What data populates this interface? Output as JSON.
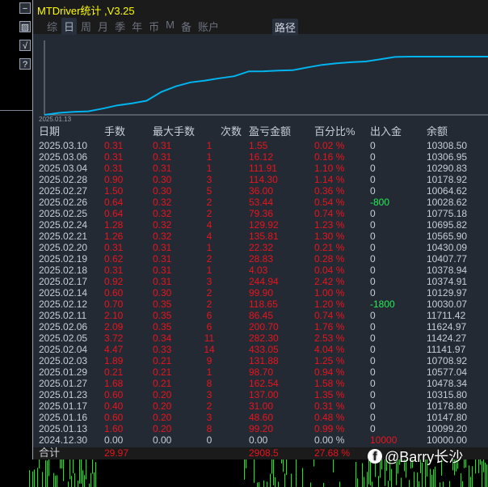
{
  "sidebar": {
    "buttons": [
      {
        "icon": "minus-icon",
        "glyph": "−"
      },
      {
        "icon": "image-icon",
        "glyph": "▨"
      },
      {
        "icon": "check-icon",
        "glyph": "√"
      },
      {
        "icon": "help-icon",
        "glyph": "?"
      }
    ]
  },
  "title": "MTDriver统计 ,V3.25",
  "tabs": [
    {
      "label": "综",
      "active": false
    },
    {
      "label": "日",
      "active": true
    },
    {
      "label": "周",
      "active": false
    },
    {
      "label": "月",
      "active": false
    },
    {
      "label": "季",
      "active": false
    },
    {
      "label": "年",
      "active": false
    },
    {
      "label": "币",
      "active": false
    },
    {
      "label": "M",
      "active": false
    },
    {
      "label": "备",
      "active": false
    },
    {
      "label": "账户",
      "active": false
    }
  ],
  "route_label": "路径",
  "chart": {
    "start_date": "2025.01.13",
    "line_color": "#00b4f0"
  },
  "table": {
    "headers": [
      "日期",
      "手数",
      "最大手数",
      "次数",
      "盈亏金额",
      "百分比%",
      "出入金",
      "余额"
    ],
    "rows": [
      [
        "2025.03.10",
        "0.31",
        "0.31",
        "1",
        "1.55",
        "0.02 %",
        "0",
        "10308.50"
      ],
      [
        "2025.03.06",
        "0.31",
        "0.31",
        "1",
        "16.12",
        "0.16 %",
        "0",
        "10306.95"
      ],
      [
        "2025.03.04",
        "0.31",
        "0.31",
        "1",
        "111.91",
        "1.10 %",
        "0",
        "10290.83"
      ],
      [
        "2025.02.28",
        "0.90",
        "0.30",
        "3",
        "114.30",
        "1.14 %",
        "0",
        "10178.92"
      ],
      [
        "2025.02.27",
        "1.50",
        "0.30",
        "5",
        "36.00",
        "0.36 %",
        "0",
        "10064.62"
      ],
      [
        "2025.02.26",
        "0.64",
        "0.32",
        "2",
        "53.44",
        "0.54 %",
        "-800",
        "10028.62"
      ],
      [
        "2025.02.25",
        "0.64",
        "0.32",
        "2",
        "79.36",
        "0.74 %",
        "0",
        "10775.18"
      ],
      [
        "2025.02.24",
        "1.28",
        "0.32",
        "4",
        "129.92",
        "1.23 %",
        "0",
        "10695.82"
      ],
      [
        "2025.02.21",
        "1.26",
        "0.32",
        "4",
        "135.81",
        "1.30 %",
        "0",
        "10565.90"
      ],
      [
        "2025.02.20",
        "0.31",
        "0.31",
        "1",
        "22.32",
        "0.21 %",
        "0",
        "10430.09"
      ],
      [
        "2025.02.19",
        "0.62",
        "0.31",
        "2",
        "28.83",
        "0.28 %",
        "0",
        "10407.77"
      ],
      [
        "2025.02.18",
        "0.31",
        "0.31",
        "1",
        "4.03",
        "0.04 %",
        "0",
        "10378.94"
      ],
      [
        "2025.02.17",
        "0.92",
        "0.31",
        "3",
        "244.94",
        "2.42 %",
        "0",
        "10374.91"
      ],
      [
        "2025.02.14",
        "0.60",
        "0.30",
        "2",
        "99.90",
        "1.00 %",
        "0",
        "10129.97"
      ],
      [
        "2025.02.12",
        "0.70",
        "0.35",
        "2",
        "118.65",
        "1.20 %",
        "-1800",
        "10030.07"
      ],
      [
        "2025.02.11",
        "2.10",
        "0.35",
        "6",
        "86.45",
        "0.74 %",
        "0",
        "11711.42"
      ],
      [
        "2025.02.06",
        "2.09",
        "0.35",
        "6",
        "200.70",
        "1.76 %",
        "0",
        "11624.97"
      ],
      [
        "2025.02.05",
        "3.72",
        "0.34",
        "11",
        "282.30",
        "2.53 %",
        "0",
        "11424.27"
      ],
      [
        "2025.02.04",
        "4.47",
        "0.33",
        "14",
        "433.05",
        "4.04 %",
        "0",
        "11141.97"
      ],
      [
        "2025.02.03",
        "1.89",
        "0.21",
        "9",
        "131.88",
        "1.25 %",
        "0",
        "10708.92"
      ],
      [
        "2025.01.29",
        "0.21",
        "0.21",
        "1",
        "98.70",
        "0.94 %",
        "0",
        "10577.04"
      ],
      [
        "2025.01.27",
        "1.68",
        "0.21",
        "8",
        "162.54",
        "1.58 %",
        "0",
        "10478.34"
      ],
      [
        "2025.01.23",
        "0.60",
        "0.20",
        "3",
        "137.00",
        "1.35 %",
        "0",
        "10315.80"
      ],
      [
        "2025.01.17",
        "0.40",
        "0.20",
        "2",
        "31.00",
        "0.31 %",
        "0",
        "10178.80"
      ],
      [
        "2025.01.16",
        "0.60",
        "0.20",
        "3",
        "48.60",
        "0.48 %",
        "0",
        "10147.80"
      ],
      [
        "2025.01.13",
        "1.60",
        "0.20",
        "8",
        "99.20",
        "0.99 %",
        "0",
        "10099.20"
      ],
      [
        "2024.12.30",
        "0.00",
        "0.00",
        "0",
        "0.00",
        "0.00 %",
        "10000",
        "10000.00"
      ]
    ],
    "total": {
      "label": "合计",
      "lots": "29.97",
      "pl": "2908.5",
      "pct": "27.68 %"
    }
  },
  "watermark": "@Barry长沙",
  "colors": {
    "profit": "#e8141e",
    "withdraw": "#22ee55",
    "text": "#c8cdd6",
    "bg": "#242a33"
  }
}
